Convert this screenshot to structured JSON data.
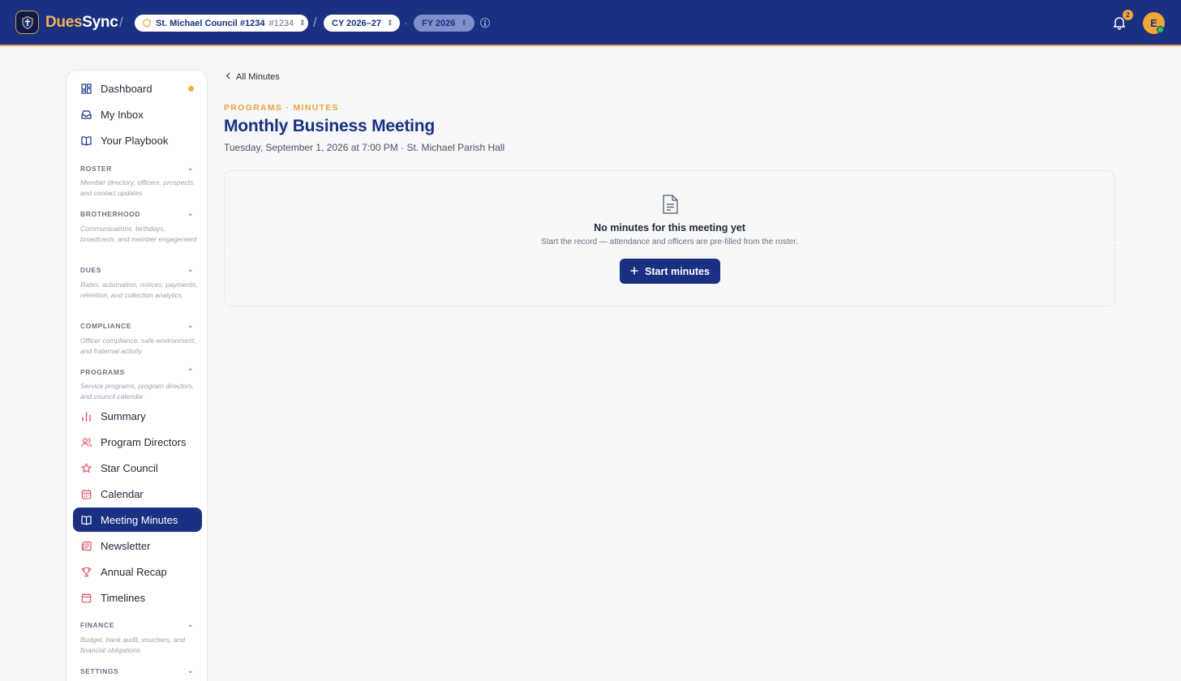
{
  "header": {
    "brand_part1": "Dues",
    "brand_part2": "Sync",
    "council_name": "St. Michael Council #1234",
    "council_number": "#1234",
    "year_selector": "CY 2026–27",
    "fiscal_selector": "FY 2026",
    "notification_count": "2",
    "avatar_initial": "E"
  },
  "sidebar": {
    "top_items": [
      {
        "label": "Dashboard",
        "icon": "dashboard-icon"
      },
      {
        "label": "My Inbox",
        "icon": "inbox-icon"
      },
      {
        "label": "Your Playbook",
        "icon": "book-icon"
      }
    ],
    "sections": [
      {
        "title": "ROSTER",
        "description": "Member directory, officers, prospects, and contact updates",
        "expanded": false
      },
      {
        "title": "BROTHERHOOD",
        "description": "Communications, birthdays, broadcasts, and member engagement",
        "expanded": false
      },
      {
        "title": "DUES",
        "description": "Rates, automation, notices, payments, retention, and collection analytics",
        "expanded": false
      },
      {
        "title": "COMPLIANCE",
        "description": "Officer compliance, safe environment, and fraternal activity",
        "expanded": false
      },
      {
        "title": "PROGRAMS",
        "description": "Service programs, program directors, and council calendar",
        "expanded": true
      },
      {
        "title": "FINANCE",
        "description": "Budget, bank audit, vouchers, and financial obligations",
        "expanded": false
      },
      {
        "title": "SETTINGS",
        "description": "",
        "expanded": false
      }
    ],
    "program_items": [
      {
        "label": "Summary",
        "icon": "bar-chart-icon"
      },
      {
        "label": "Program Directors",
        "icon": "users-icon"
      },
      {
        "label": "Star Council",
        "icon": "star-icon"
      },
      {
        "label": "Calendar",
        "icon": "calendar-icon"
      },
      {
        "label": "Meeting Minutes",
        "icon": "book-open-icon",
        "active": true
      },
      {
        "label": "Newsletter",
        "icon": "newspaper-icon"
      },
      {
        "label": "Annual Recap",
        "icon": "trophy-icon"
      },
      {
        "label": "Timelines",
        "icon": "calendar-icon"
      }
    ]
  },
  "main": {
    "breadcrumb": "All Minutes",
    "eyebrow": "PROGRAMS · MINUTES",
    "title": "Monthly Business Meeting",
    "subtitle": "Tuesday, September 1, 2026 at 7:00 PM · St. Michael Parish Hall",
    "empty_state": {
      "title": "No minutes for this meeting yet",
      "description": "Start the record — attendance and officers are pre-filled from the roster.",
      "button_label": "Start minutes"
    }
  },
  "colors": {
    "primary": "#1a3182",
    "accent": "#f0a733",
    "program_icon": "#e05566"
  }
}
